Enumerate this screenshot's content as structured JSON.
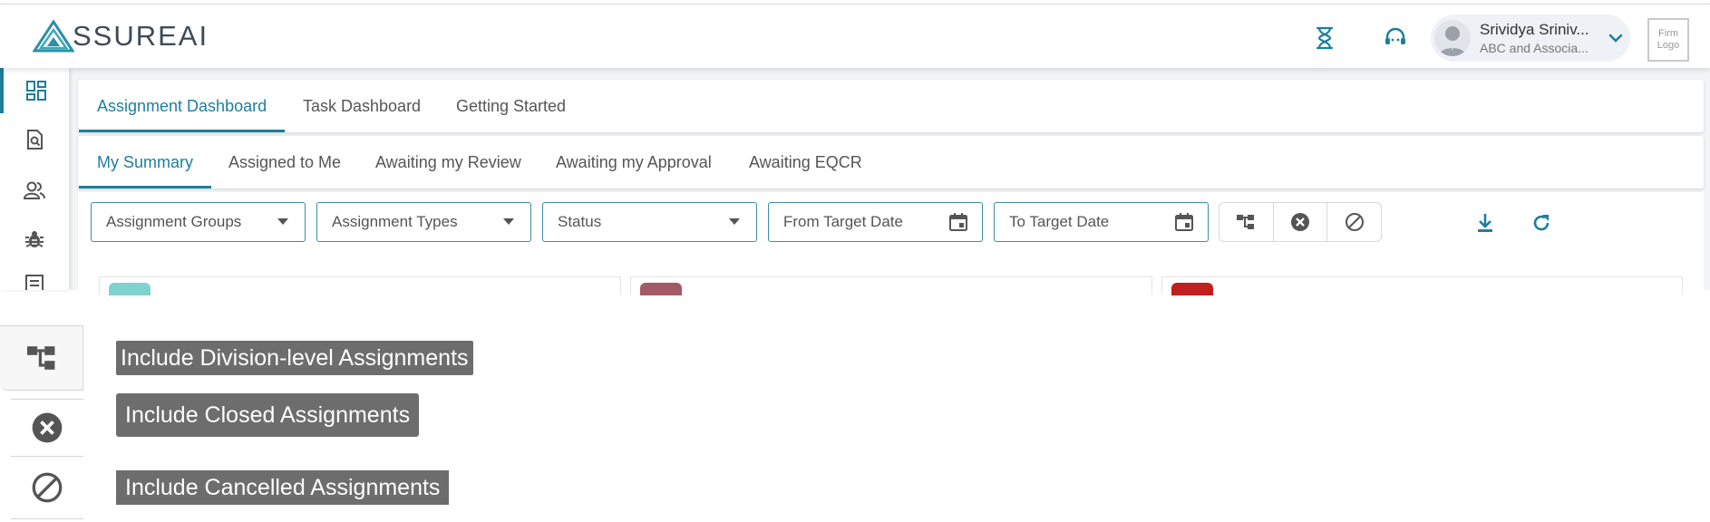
{
  "header": {
    "logo_text": "SSUREAI",
    "user": {
      "name": "Srividya Sriniv...",
      "org": "ABC and Associa..."
    },
    "firm_logo": "Firm Logo"
  },
  "sidebar": {
    "items": [
      {
        "icon": "dashboard-icon",
        "active": true
      },
      {
        "icon": "document-search-icon",
        "active": false
      },
      {
        "icon": "users-icon",
        "active": false
      },
      {
        "icon": "bug-icon",
        "active": false
      },
      {
        "icon": "list-icon",
        "active": false
      }
    ]
  },
  "tabs": [
    {
      "label": "Assignment Dashboard",
      "active": true
    },
    {
      "label": "Task Dashboard",
      "active": false
    },
    {
      "label": "Getting Started",
      "active": false
    }
  ],
  "subtabs": [
    {
      "label": "My Summary",
      "active": true
    },
    {
      "label": "Assigned to Me",
      "active": false
    },
    {
      "label": "Awaiting my Review",
      "active": false
    },
    {
      "label": "Awaiting my Approval",
      "active": false
    },
    {
      "label": "Awaiting EQCR",
      "active": false
    }
  ],
  "filters": {
    "assignment_groups": "Assignment Groups",
    "assignment_types": "Assignment Types",
    "status": "Status",
    "from_target_date": "From Target Date",
    "to_target_date": "To Target Date"
  },
  "tooltips": {
    "division": "Include Division-level Assignments",
    "closed": "Include Closed Assignments",
    "cancelled": "Include Cancelled Assignments"
  },
  "colors": {
    "accent": "#1d7f9b",
    "card1_pill": "#7fd3cf",
    "card2_pill": "#a35a66",
    "card3_pill": "#c0201f"
  }
}
